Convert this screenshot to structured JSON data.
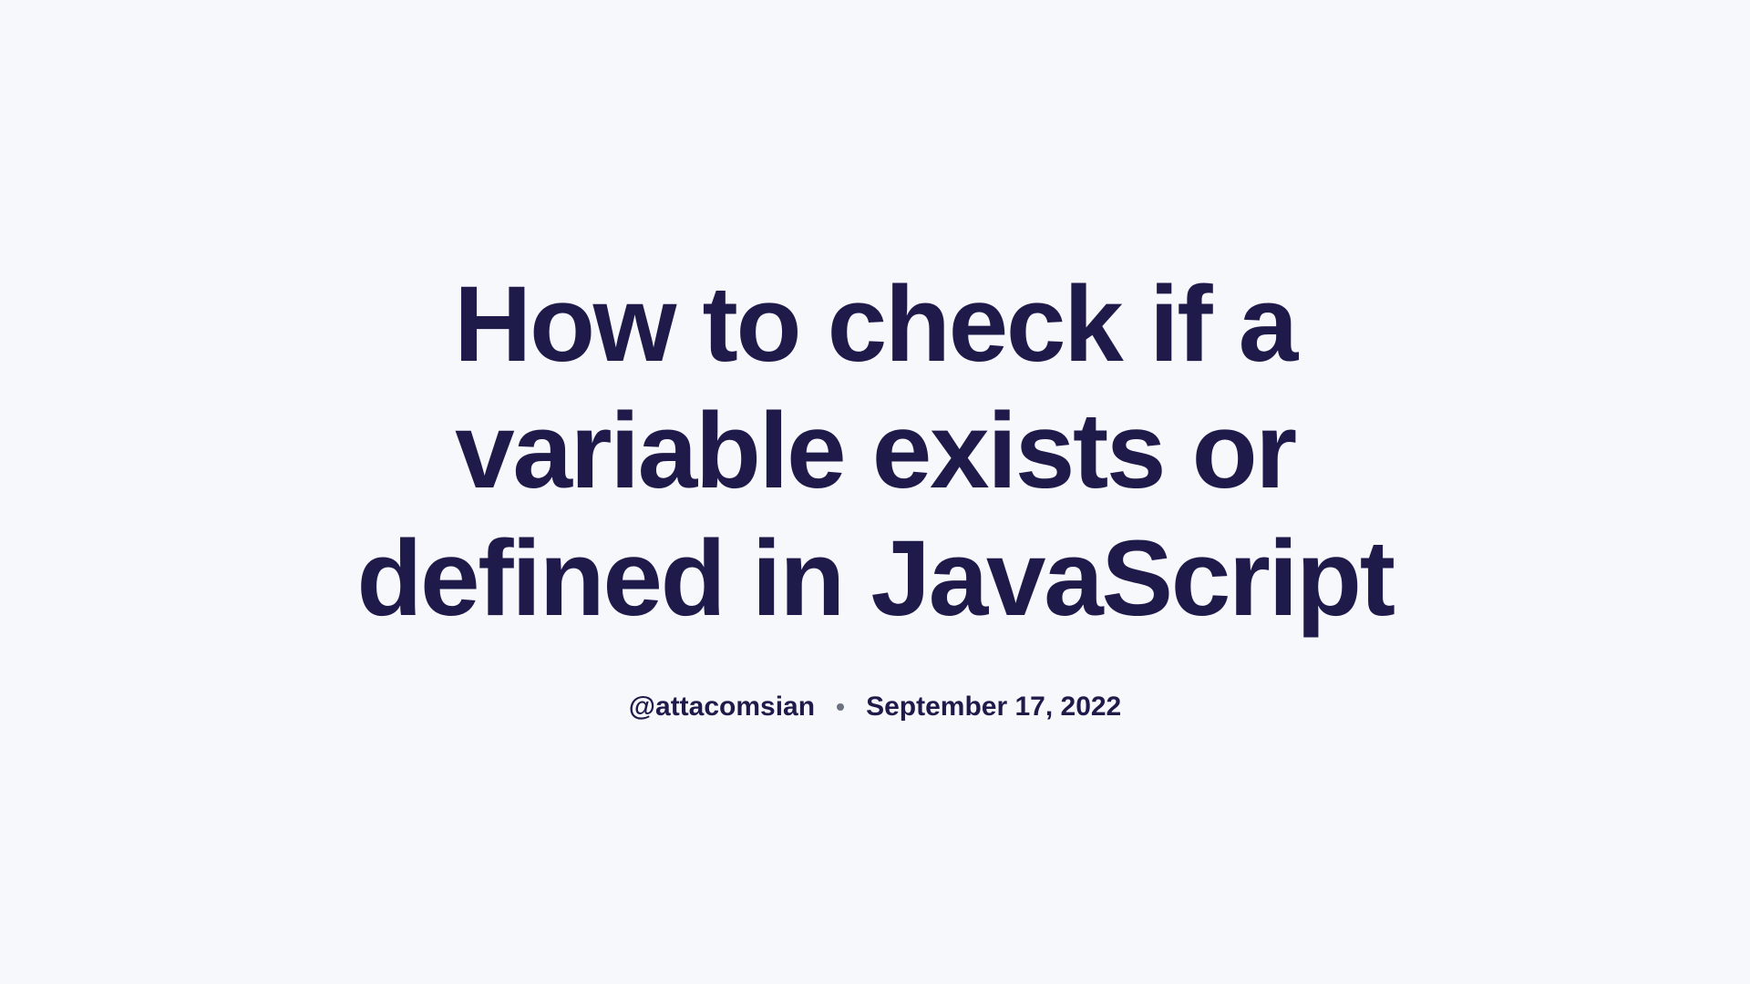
{
  "article": {
    "title": "How to check if a variable exists or defined in JavaScript",
    "author": "@attacomsian",
    "date": "September 17, 2022"
  },
  "colors": {
    "background": "#f6f8fc",
    "text": "#1e1b4b",
    "bullet": "#6b7280"
  }
}
